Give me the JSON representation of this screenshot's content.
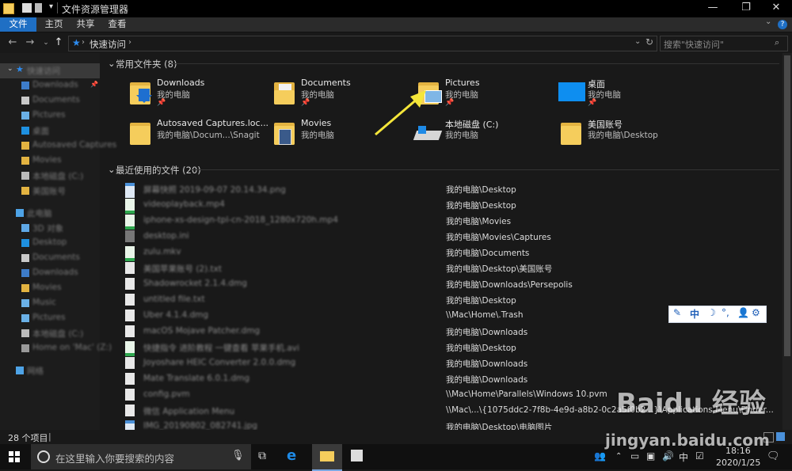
{
  "window": {
    "title": "文件资源管理器",
    "controls": {
      "minimize": "—",
      "maximize": "❐",
      "close": "✕"
    }
  },
  "ribbon": {
    "tabs": [
      "文件",
      "主页",
      "共享",
      "查看"
    ]
  },
  "nav": {
    "address": "快速访问",
    "search_placeholder": "搜索\"快速访问\""
  },
  "sidebar": {
    "items": [
      "快速访问",
      "Downloads",
      "Documents",
      "Pictures",
      "桌面",
      "Autosaved Captures",
      "Movies",
      "本地磁盘 (C:)",
      "美国账号",
      "此电脑",
      "3D 对象",
      "Desktop",
      "Documents",
      "Downloads",
      "Movies",
      "Music",
      "Pictures",
      "本地磁盘 (C:)",
      "Home on 'Mac' (Z:)",
      "网络"
    ]
  },
  "frequent": {
    "header": "常用文件夹 (8)",
    "items": [
      {
        "name": "Downloads",
        "location": "我的电脑",
        "pinned": true,
        "icon": "downloads-folder-icon"
      },
      {
        "name": "Documents",
        "location": "我的电脑",
        "pinned": true,
        "icon": "documents-folder-icon"
      },
      {
        "name": "Pictures",
        "location": "我的电脑",
        "pinned": true,
        "icon": "pictures-folder-icon"
      },
      {
        "name": "桌面",
        "location": "我的电脑",
        "pinned": true,
        "icon": "desktop-folder-icon"
      },
      {
        "name": "Autosaved Captures.loc...",
        "location": "我的电脑\\Docum...\\Snagit",
        "pinned": false,
        "icon": "folder-icon"
      },
      {
        "name": "Movies",
        "location": "我的电脑",
        "pinned": false,
        "icon": "movies-folder-icon"
      },
      {
        "name": "本地磁盘 (C:)",
        "location": "我的电脑",
        "pinned": false,
        "icon": "drive-icon"
      },
      {
        "name": "美国账号",
        "location": "我的电脑\\Desktop",
        "pinned": false,
        "icon": "folder-icon"
      }
    ]
  },
  "recent": {
    "header": "最近使用的文件 (20)",
    "items": [
      {
        "name": "屏幕快照 2019-09-07 20.14.34.png",
        "path": "我的电脑\\Desktop",
        "icon": "image-file-icon"
      },
      {
        "name": "videoplayback.mp4",
        "path": "我的电脑\\Desktop",
        "icon": "video-file-icon"
      },
      {
        "name": "iphone-xs-design-tpl-cn-2018_1280x720h.mp4",
        "path": "我的电脑\\Movies",
        "icon": "video-file-icon"
      },
      {
        "name": "desktop.ini",
        "path": "我的电脑\\Movies\\Captures",
        "icon": "settings-file-icon"
      },
      {
        "name": "zulu.mkv",
        "path": "我的电脑\\Documents",
        "icon": "video-file-icon"
      },
      {
        "name": "美国苹果账号 (2).txt",
        "path": "我的电脑\\Desktop\\美国账号",
        "icon": "text-file-icon"
      },
      {
        "name": "Shadowrocket 2.1.4.dmg",
        "path": "我的电脑\\Downloads\\Persepolis",
        "icon": "file-icon"
      },
      {
        "name": "untitled file.txt",
        "path": "我的电脑\\Desktop",
        "icon": "text-file-icon"
      },
      {
        "name": "Uber 4.1.4.dmg",
        "path": "\\\\Mac\\Home\\.Trash",
        "icon": "file-icon"
      },
      {
        "name": "macOS Mojave Patcher.dmg",
        "path": "我的电脑\\Downloads",
        "icon": "file-icon"
      },
      {
        "name": "快捷指令 进阶教程 一键查看 苹果手机.avi",
        "path": "我的电脑\\Desktop",
        "icon": "video-file-icon"
      },
      {
        "name": "Joyoshare HEIC Converter 2.0.0.dmg",
        "path": "我的电脑\\Downloads",
        "icon": "file-icon"
      },
      {
        "name": "Mate Translate 6.0.1.dmg",
        "path": "我的电脑\\Downloads",
        "icon": "file-icon"
      },
      {
        "name": "config.pvm",
        "path": "\\\\Mac\\Home\\Parallels\\Windows 10.pvm",
        "icon": "file-icon"
      },
      {
        "name": "微信 Application Menu",
        "path": "\\\\Mac\\...\\{1075ddc2-7f8b-4e9d-a8b2-0c2a5f0b2...}\\Applications Menu\\Finder...",
        "icon": "file-icon"
      },
      {
        "name": "IMG_20190802_082741.jpg",
        "path": "我的电脑\\Desktop\\电脑图片",
        "icon": "image-file-icon"
      }
    ]
  },
  "status": {
    "count": "28 个项目"
  },
  "taskbar": {
    "search_text": "在这里输入你要搜索的内容",
    "ime": "中",
    "time": "18:16",
    "date": "2020/1/25"
  },
  "imebar": {
    "lang": "中"
  },
  "watermark": {
    "line1": "Baidu 经验",
    "line2": "jingyan.baidu.com"
  },
  "colors": {
    "accent": "#1f6fc4",
    "folder": "#f5cd5c",
    "background": "#191919"
  }
}
